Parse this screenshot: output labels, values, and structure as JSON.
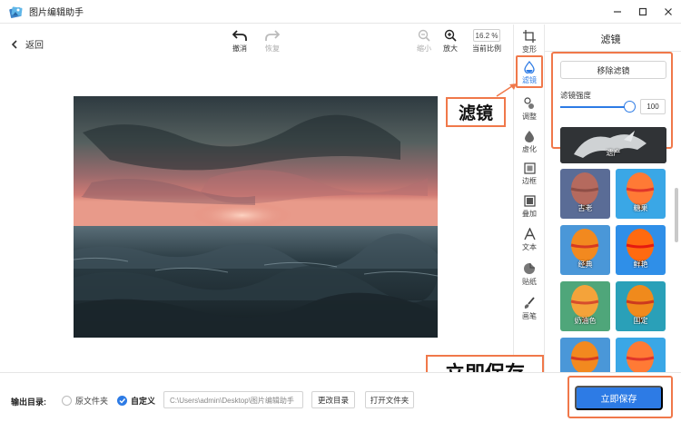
{
  "app": {
    "title": "图片编辑助手"
  },
  "toolbar": {
    "back_label": "返回",
    "undo_label": "撤消",
    "redo_label": "恢复",
    "zoom_out_label": "缩小",
    "zoom_in_label": "放大",
    "zoom_value": "16.2 %",
    "current_ratio_label": "当前比例"
  },
  "strip": {
    "items": [
      {
        "label": "变形",
        "icon": "crop-icon"
      },
      {
        "label": "滤镜",
        "icon": "filter-drop-icon",
        "active": true
      },
      {
        "label": "调整",
        "icon": "adjust-icon"
      },
      {
        "label": "虚化",
        "icon": "blur-drop-icon"
      },
      {
        "label": "边框",
        "icon": "border-icon"
      },
      {
        "label": "叠加",
        "icon": "overlay-icon"
      },
      {
        "label": "文本",
        "icon": "text-icon"
      },
      {
        "label": "贴纸",
        "icon": "sticker-icon"
      },
      {
        "label": "画笔",
        "icon": "brush-icon"
      }
    ]
  },
  "panel": {
    "title": "滤镜",
    "remove_filter_label": "移除滤镜",
    "strength_label": "滤镜强度",
    "strength_value": "100",
    "strength_fraction": 1.0,
    "filters": [
      {
        "name": "遗产",
        "style": "gray"
      },
      {
        "name": "古老",
        "style": "vintage"
      },
      {
        "name": "糖果",
        "style": "candy"
      },
      {
        "name": "经典",
        "style": "classic"
      },
      {
        "name": "鲜艳",
        "style": "vivid"
      },
      {
        "name": "奶油色",
        "style": "cream"
      },
      {
        "name": "固定",
        "style": "fixed"
      },
      {
        "name": "",
        "style": "classic"
      },
      {
        "name": "",
        "style": "candy"
      }
    ]
  },
  "callouts": {
    "filter_label": "滤镜",
    "save_label": "立即保存"
  },
  "bottom": {
    "output_label": "输出目录:",
    "option_original": "原文件夹",
    "option_custom": "自定义",
    "path_value": "C:\\Users\\admin\\Desktop\\图片编辑助手",
    "change_dir_label": "更改目录",
    "open_folder_label": "打开文件夹",
    "save_button_label": "立即保存"
  },
  "colors": {
    "accent": "#2d7be5",
    "callout_border": "#f0784a"
  }
}
